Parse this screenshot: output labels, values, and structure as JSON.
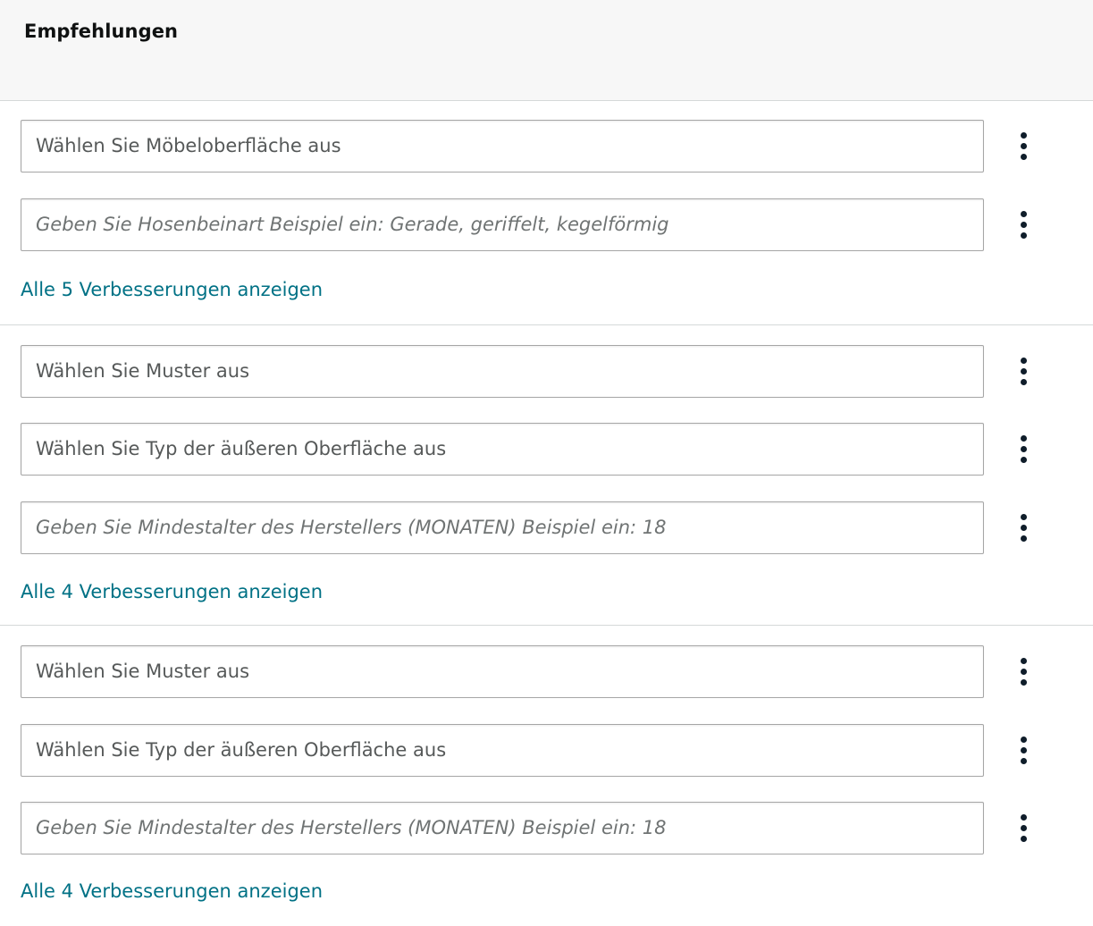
{
  "header": {
    "title": "Empfehlungen"
  },
  "sections": [
    {
      "fields": [
        {
          "text": "Wählen Sie Möbeloberfläche aus",
          "kind": "select"
        },
        {
          "text": "Geben Sie Hosenbeinart Beispiel ein: Gerade, geriffelt, kegelförmig",
          "kind": "placeholder"
        }
      ],
      "show_all_label": "Alle 5 Verbesserungen anzeigen"
    },
    {
      "fields": [
        {
          "text": "Wählen Sie Muster aus",
          "kind": "select"
        },
        {
          "text": "Wählen Sie Typ der äußeren Oberfläche aus",
          "kind": "select"
        },
        {
          "text": "Geben Sie Mindestalter des Herstellers (MONATEN) Beispiel ein: 18",
          "kind": "placeholder"
        }
      ],
      "show_all_label": "Alle 4 Verbesserungen anzeigen"
    },
    {
      "fields": [
        {
          "text": "Wählen Sie Muster aus",
          "kind": "select"
        },
        {
          "text": "Wählen Sie Typ der äußeren Oberfläche aus",
          "kind": "select"
        },
        {
          "text": "Geben Sie Mindestalter des Herstellers (MONATEN) Beispiel ein: 18",
          "kind": "placeholder"
        }
      ],
      "show_all_label": "Alle 4 Verbesserungen anzeigen"
    }
  ],
  "icons": {
    "field_menu": "more-vertical-icon"
  },
  "colors": {
    "link": "#007185",
    "field_text": "#565959",
    "header_bg": "#f7f7f7",
    "divider": "#d5d9d9"
  }
}
